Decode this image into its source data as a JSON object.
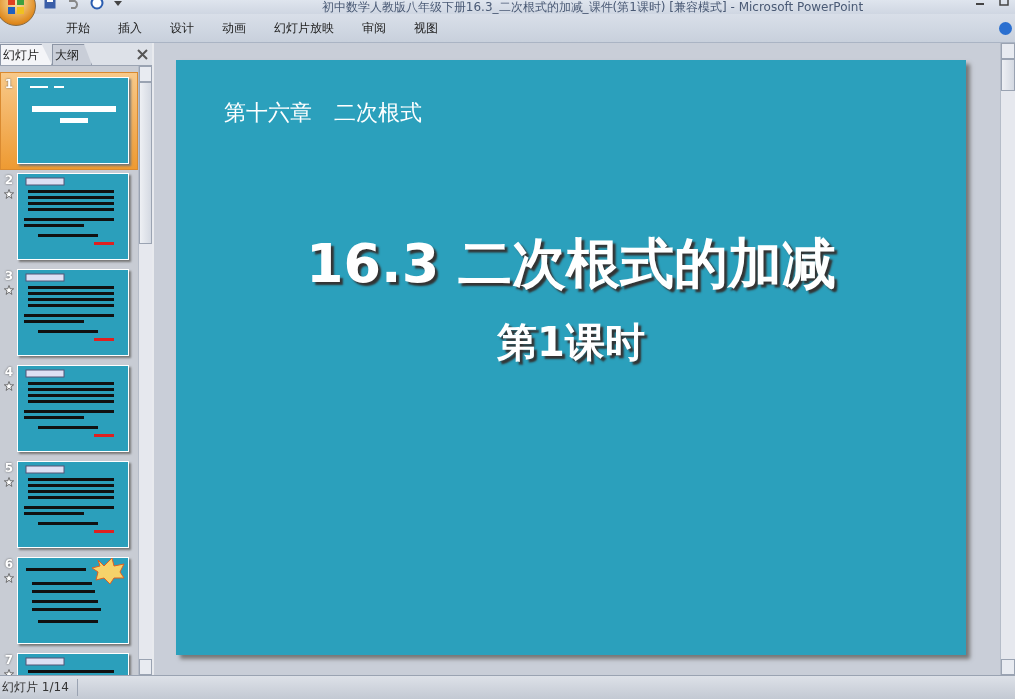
{
  "window": {
    "title": "初中数学人教版八年级下册16.3_二次根式的加减_课件(第1课时) [兼容模式] - Microsoft PowerPoint"
  },
  "ribbon_tabs": [
    {
      "label": "开始"
    },
    {
      "label": "插入"
    },
    {
      "label": "设计"
    },
    {
      "label": "动画"
    },
    {
      "label": "幻灯片放映"
    },
    {
      "label": "审阅"
    },
    {
      "label": "视图"
    }
  ],
  "panel_tabs": [
    {
      "label": "幻灯片",
      "selected": true
    },
    {
      "label": "大纲",
      "selected": false
    }
  ],
  "slides": [
    {
      "number": "1",
      "selected": true,
      "animated": false,
      "kind": "title"
    },
    {
      "number": "2",
      "selected": false,
      "animated": true,
      "kind": "text"
    },
    {
      "number": "3",
      "selected": false,
      "animated": true,
      "kind": "text"
    },
    {
      "number": "4",
      "selected": false,
      "animated": true,
      "kind": "text"
    },
    {
      "number": "5",
      "selected": false,
      "animated": true,
      "kind": "text"
    },
    {
      "number": "6",
      "selected": false,
      "animated": true,
      "kind": "burst"
    },
    {
      "number": "7",
      "selected": false,
      "animated": true,
      "kind": "text"
    }
  ],
  "slide": {
    "chapter": "第十六章　二次根式",
    "title": "16.3 二次根式的加减",
    "subtitle": "第1课时"
  },
  "status_bar": {
    "slide_count": "幻灯片 1/14"
  }
}
